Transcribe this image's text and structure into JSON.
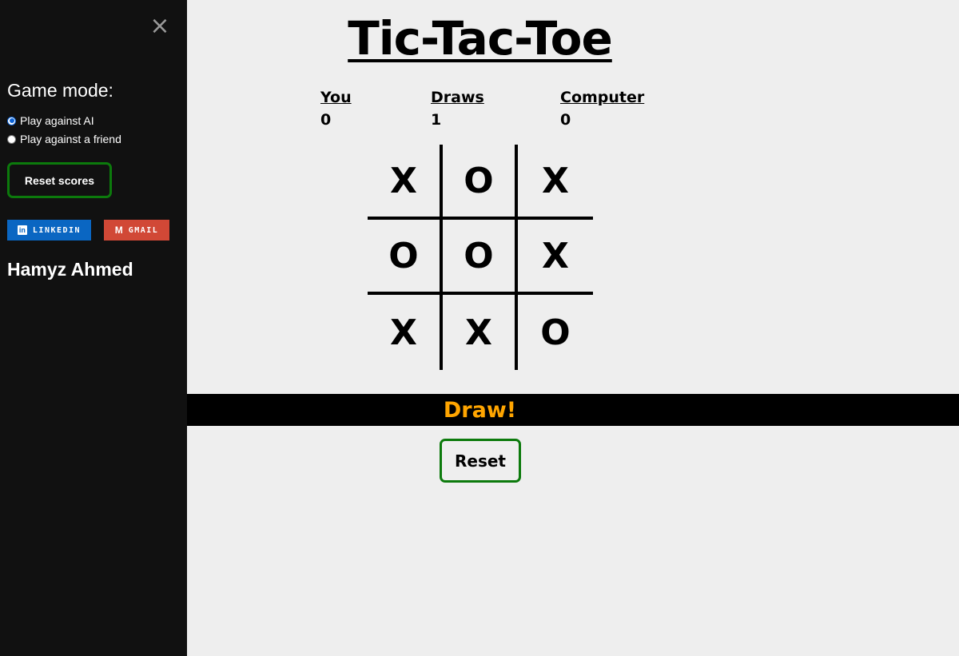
{
  "sidebar": {
    "close_icon": "×",
    "game_mode_title": "Game mode:",
    "modes": [
      {
        "label": "Play against AI",
        "checked": true
      },
      {
        "label": "Play against a friend",
        "checked": false
      }
    ],
    "reset_scores_label": "Reset scores",
    "links": {
      "linkedin_label": "LINKEDIN",
      "linkedin_icon": "in",
      "gmail_label": "GMAIL",
      "gmail_icon": "M"
    },
    "author": "Hamyz Ahmed"
  },
  "main": {
    "title": "Tic-Tac-Toe",
    "scores": {
      "you_label": "You",
      "you_value": "0",
      "draws_label": "Draws",
      "draws_value": "1",
      "computer_label": "Computer",
      "computer_value": "0"
    },
    "board": [
      [
        "X",
        "O",
        "X"
      ],
      [
        "O",
        "O",
        "X"
      ],
      [
        "X",
        "X",
        "O"
      ]
    ],
    "status": "Draw!",
    "reset_label": "Reset"
  },
  "colors": {
    "sidebar_bg": "#111111",
    "main_bg": "#eeeeee",
    "accent_green": "#0c7a0c",
    "status_orange": "#ffa500",
    "linkedin_blue": "#0a66c2",
    "gmail_red": "#d14836"
  }
}
